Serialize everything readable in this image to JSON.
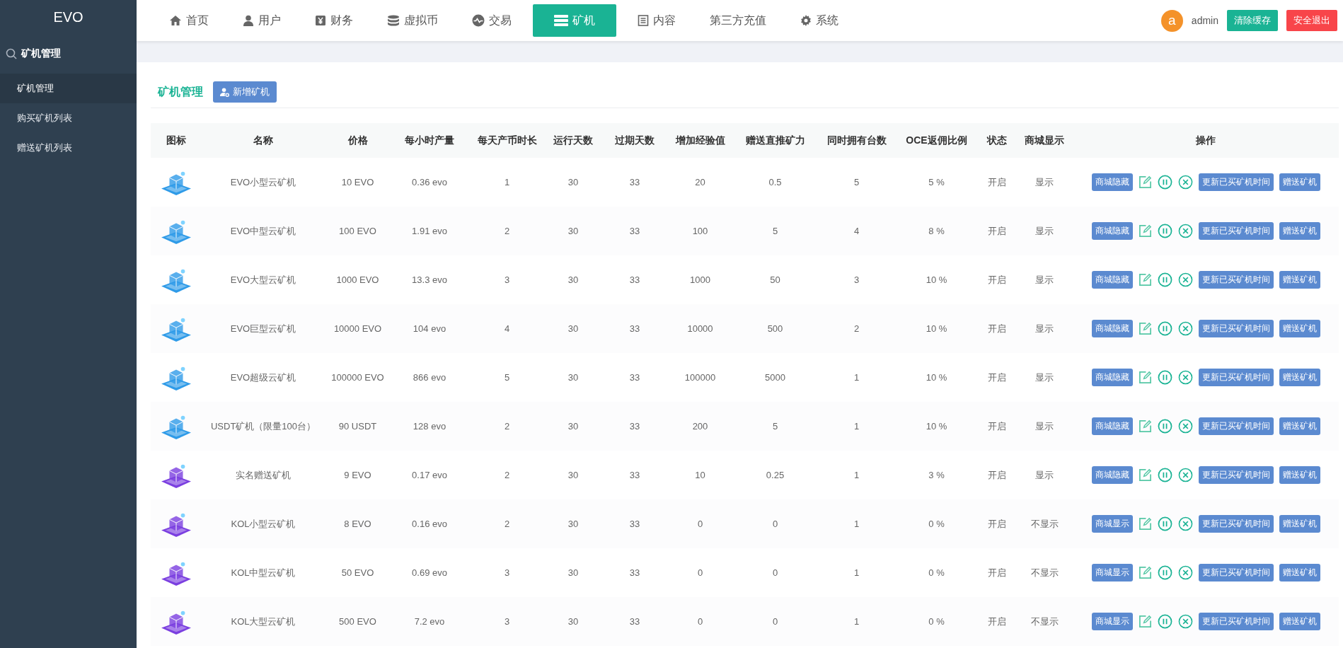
{
  "brand": "EVO",
  "nav": [
    {
      "label": "首页",
      "kind": "home",
      "selected": false
    },
    {
      "label": "用户",
      "kind": "user",
      "selected": false
    },
    {
      "label": "财务",
      "kind": "cash",
      "selected": false
    },
    {
      "label": "虚拟币",
      "kind": "database",
      "selected": false
    },
    {
      "label": "交易",
      "kind": "wave",
      "selected": false
    },
    {
      "label": "矿机",
      "kind": "server",
      "selected": true
    },
    {
      "label": "内容",
      "kind": "document",
      "selected": false
    },
    {
      "label": "第三方充值",
      "kind": "plain",
      "selected": false
    },
    {
      "label": "系统",
      "kind": "gear",
      "selected": false
    }
  ],
  "user": {
    "avatar_letter": "a",
    "name": "admin",
    "clear_cache": "清除缓存",
    "logout": "安全退出"
  },
  "sidebar": {
    "heading": "矿机管理",
    "items": [
      {
        "label": "矿机管理",
        "selected": true
      },
      {
        "label": "购买矿机列表",
        "selected": false
      },
      {
        "label": "赠送矿机列表",
        "selected": false
      }
    ]
  },
  "page": {
    "title": "矿机管理",
    "add_button": "新增矿机"
  },
  "table": {
    "columns": [
      "图标",
      "名称",
      "价格",
      "每小时产量",
      "每天产币时长",
      "运行天数",
      "过期天数",
      "增加经验值",
      "赠送直推矿力",
      "同时拥有台数",
      "OCE返佣比例",
      "状态",
      "商城显示",
      "操作"
    ],
    "rows": [
      {
        "color": "#2f9be8",
        "name": "EVO小型云矿机",
        "price": "10 EVO",
        "hourly": "0.36 evo",
        "daily_hours": "1",
        "run_days": "30",
        "expire_days": "33",
        "exp": "20",
        "bonus_power": "0.5",
        "max_owned": "5",
        "rebate": "5 %",
        "status": "开启",
        "shop": "显示",
        "shop_button": "商城隐藏",
        "update_button": "更新已买矿机时间",
        "gift_button": "赠送矿机"
      },
      {
        "color": "#2f9be8",
        "name": "EVO中型云矿机",
        "price": "100 EVO",
        "hourly": "1.91 evo",
        "daily_hours": "2",
        "run_days": "30",
        "expire_days": "33",
        "exp": "100",
        "bonus_power": "5",
        "max_owned": "4",
        "rebate": "8 %",
        "status": "开启",
        "shop": "显示",
        "shop_button": "商城隐藏",
        "update_button": "更新已买矿机时间",
        "gift_button": "赠送矿机"
      },
      {
        "color": "#2f9be8",
        "name": "EVO大型云矿机",
        "price": "1000 EVO",
        "hourly": "13.3 evo",
        "daily_hours": "3",
        "run_days": "30",
        "expire_days": "33",
        "exp": "1000",
        "bonus_power": "50",
        "max_owned": "3",
        "rebate": "10 %",
        "status": "开启",
        "shop": "显示",
        "shop_button": "商城隐藏",
        "update_button": "更新已买矿机时间",
        "gift_button": "赠送矿机"
      },
      {
        "color": "#2f9be8",
        "name": "EVO巨型云矿机",
        "price": "10000 EVO",
        "hourly": "104 evo",
        "daily_hours": "4",
        "run_days": "30",
        "expire_days": "33",
        "exp": "10000",
        "bonus_power": "500",
        "max_owned": "2",
        "rebate": "10 %",
        "status": "开启",
        "shop": "显示",
        "shop_button": "商城隐藏",
        "update_button": "更新已买矿机时间",
        "gift_button": "赠送矿机"
      },
      {
        "color": "#2f9be8",
        "name": "EVO超级云矿机",
        "price": "100000 EVO",
        "hourly": "866 evo",
        "daily_hours": "5",
        "run_days": "30",
        "expire_days": "33",
        "exp": "100000",
        "bonus_power": "5000",
        "max_owned": "1",
        "rebate": "10 %",
        "status": "开启",
        "shop": "显示",
        "shop_button": "商城隐藏",
        "update_button": "更新已买矿机时间",
        "gift_button": "赠送矿机"
      },
      {
        "color": "#2f9be8",
        "name": "USDT矿机（限量100台）",
        "price": "90 USDT",
        "hourly": "128 evo",
        "daily_hours": "2",
        "run_days": "30",
        "expire_days": "33",
        "exp": "200",
        "bonus_power": "5",
        "max_owned": "1",
        "rebate": "10 %",
        "status": "开启",
        "shop": "显示",
        "shop_button": "商城隐藏",
        "update_button": "更新已买矿机时间",
        "gift_button": "赠送矿机"
      },
      {
        "color": "#7b3fe0",
        "name": "实名赠送矿机",
        "price": "9 EVO",
        "hourly": "0.17 evo",
        "daily_hours": "2",
        "run_days": "30",
        "expire_days": "33",
        "exp": "10",
        "bonus_power": "0.25",
        "max_owned": "1",
        "rebate": "3 %",
        "status": "开启",
        "shop": "显示",
        "shop_button": "商城隐藏",
        "update_button": "更新已买矿机时间",
        "gift_button": "赠送矿机"
      },
      {
        "color": "#7b3fe0",
        "name": "KOL小型云矿机",
        "price": "8 EVO",
        "hourly": "0.16 evo",
        "daily_hours": "2",
        "run_days": "30",
        "expire_days": "33",
        "exp": "0",
        "bonus_power": "0",
        "max_owned": "1",
        "rebate": "0 %",
        "status": "开启",
        "shop": "不显示",
        "shop_button": "商城显示",
        "update_button": "更新已买矿机时间",
        "gift_button": "赠送矿机"
      },
      {
        "color": "#7b3fe0",
        "name": "KOL中型云矿机",
        "price": "50 EVO",
        "hourly": "0.69 evo",
        "daily_hours": "3",
        "run_days": "30",
        "expire_days": "33",
        "exp": "0",
        "bonus_power": "0",
        "max_owned": "1",
        "rebate": "0 %",
        "status": "开启",
        "shop": "不显示",
        "shop_button": "商城显示",
        "update_button": "更新已买矿机时间",
        "gift_button": "赠送矿机"
      },
      {
        "color": "#7b3fe0",
        "name": "KOL大型云矿机",
        "price": "500 EVO",
        "hourly": "7.2 evo",
        "daily_hours": "3",
        "run_days": "30",
        "expire_days": "33",
        "exp": "0",
        "bonus_power": "0",
        "max_owned": "1",
        "rebate": "0 %",
        "status": "开启",
        "shop": "不显示",
        "shop_button": "商城显示",
        "update_button": "更新已买矿机时间",
        "gift_button": "赠送矿机"
      }
    ]
  }
}
